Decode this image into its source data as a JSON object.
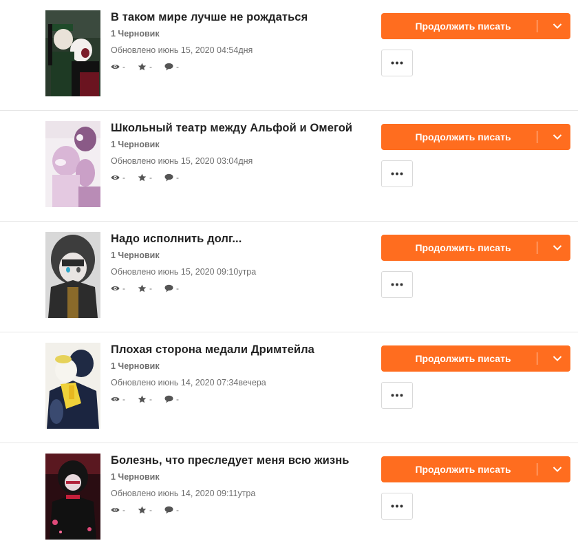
{
  "colors": {
    "accent": "#ff6d1f",
    "text_primary": "#222222",
    "text_secondary": "#6f6f6f",
    "divider": "#e6e6e6"
  },
  "stories": [
    {
      "title": "В таком мире лучше не рождаться",
      "drafts": "1 Черновик",
      "updated": "Обновлено июнь 15, 2020 04:54дня",
      "views": "-",
      "votes": "-",
      "comments": "-",
      "continue_label": "Продолжить писать",
      "cover_icon": "cover-image"
    },
    {
      "title": "Школьный театр между Альфой и Омегой",
      "drafts": "1 Черновик",
      "updated": "Обновлено июнь 15, 2020 03:04дня",
      "views": "-",
      "votes": "-",
      "comments": "-",
      "continue_label": "Продолжить писать",
      "cover_icon": "cover-image"
    },
    {
      "title": "Надо исполнить долг...",
      "drafts": "1 Черновик",
      "updated": "Обновлено июнь 15, 2020 09:10утра",
      "views": "-",
      "votes": "-",
      "comments": "-",
      "continue_label": "Продолжить писать",
      "cover_icon": "cover-image"
    },
    {
      "title": "Плохая сторона медали Дримтейла",
      "drafts": "1 Черновик",
      "updated": "Обновлено июнь 14, 2020 07:34вечера",
      "views": "-",
      "votes": "-",
      "comments": "-",
      "continue_label": "Продолжить писать",
      "cover_icon": "cover-image"
    },
    {
      "title": "Болезнь, что преследует меня всю жизнь",
      "drafts": "1 Черновик",
      "updated": "Обновлено июнь 14, 2020 09:11утра",
      "views": "-",
      "votes": "-",
      "comments": "-",
      "continue_label": "Продолжить писать",
      "cover_icon": "cover-image"
    }
  ],
  "icons": {
    "views": "eye-icon",
    "votes": "star-icon",
    "comments": "comment-icon",
    "dropdown": "chevron-down-icon",
    "more": "more-horizontal-icon"
  }
}
